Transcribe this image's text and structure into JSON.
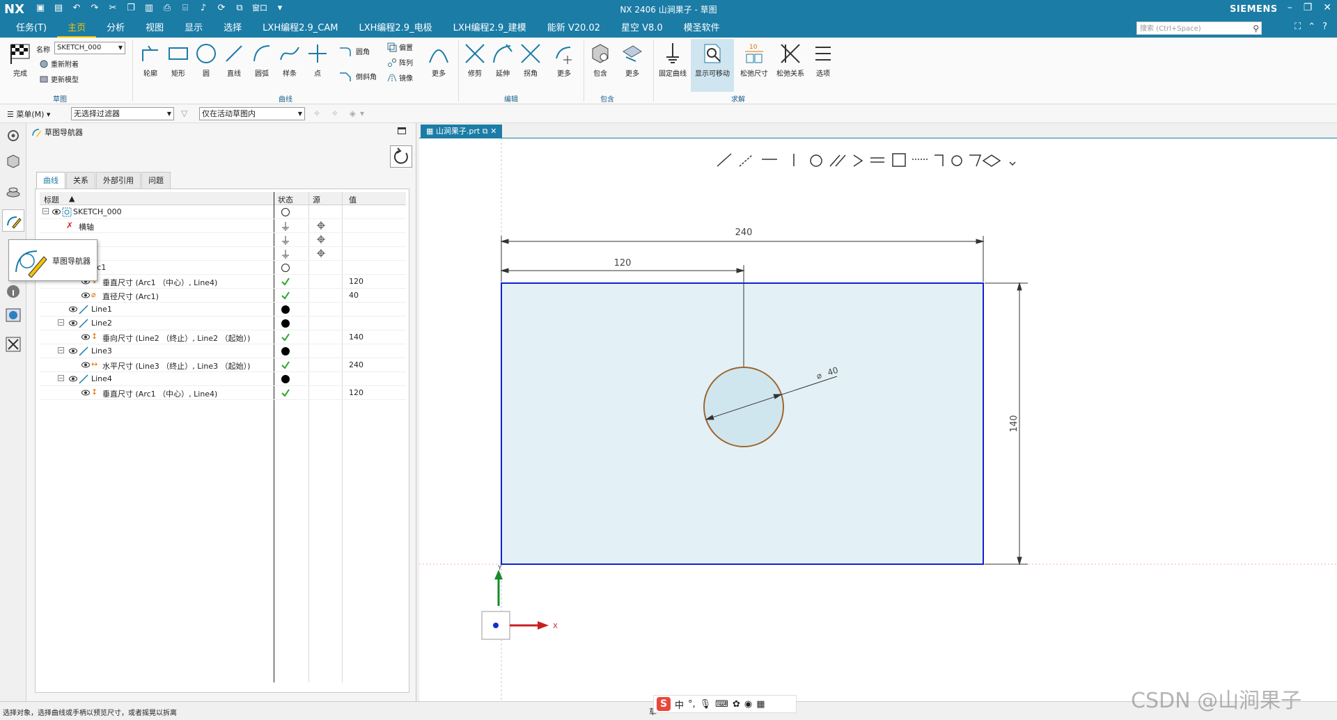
{
  "app": {
    "logo": "NX",
    "window_title": "NX 2406 山涧果子 - 草图",
    "brand": "SIEMENS",
    "window_menu": "窗口"
  },
  "menu_tabs": [
    "任务(T)",
    "主页",
    "分析",
    "视图",
    "显示",
    "选择",
    "LXH编程2.9_CAM",
    "LXH编程2.9_电极",
    "LXH编程2.9_建模",
    "能新 V20.02",
    "星空 V8.0",
    "模圣软件"
  ],
  "active_tab": "主页",
  "search_placeholder": "搜索 (Ctrl+Space)",
  "ribbon": {
    "finish": "完成",
    "name_label": "名称",
    "name_value": "SKETCH_000",
    "reattach": "重新附着",
    "update_model": "更新模型",
    "group_sketch": "草图",
    "curve_buttons": [
      "轮廓",
      "矩形",
      "圆",
      "直线",
      "圆弧",
      "样条",
      "点"
    ],
    "fillet": "圆角",
    "chamfer": "倒斜角",
    "offset": "偏置",
    "pattern": "阵列",
    "mirror": "镜像",
    "more": "更多",
    "group_curve": "曲线",
    "edit_buttons": [
      "修剪",
      "延伸",
      "拐角"
    ],
    "group_edit": "编辑",
    "include": "包含",
    "group_include": "包含",
    "solve_buttons": [
      "固定曲线",
      "显示可移动",
      "松弛尺寸",
      "松弛关系",
      "选项"
    ],
    "group_solve": "求解"
  },
  "filterbar": {
    "menu": "菜单(M)",
    "filter_value": "无选择过滤器",
    "scope_value": "仅在活动草图内"
  },
  "navigator": {
    "title": "草图导航器",
    "tabs": [
      "曲线",
      "关系",
      "外部引用",
      "问题"
    ],
    "columns": [
      "标题",
      "状态",
      "源",
      "值"
    ],
    "tooltip": "草图导航器",
    "rows": [
      {
        "label": "SKETCH_000",
        "value": ""
      },
      {
        "label": "横轴",
        "value": ""
      },
      {
        "label": "rc1",
        "value": ""
      },
      {
        "label": "垂直尺寸 (Arc1 （中心）, Line4)",
        "value": "120"
      },
      {
        "label": "直径尺寸 (Arc1)",
        "value": "40"
      },
      {
        "label": "Line1",
        "value": ""
      },
      {
        "label": "Line2",
        "value": ""
      },
      {
        "label": "垂向尺寸 (Line2 （终止）, Line2 （起始）)",
        "value": "140"
      },
      {
        "label": "Line3",
        "value": ""
      },
      {
        "label": "水平尺寸 (Line3 （终止）, Line3 （起始）)",
        "value": "240"
      },
      {
        "label": "Line4",
        "value": ""
      },
      {
        "label": "垂直尺寸 (Arc1 （中心）, Line4)",
        "value": "120"
      }
    ]
  },
  "document": {
    "tab": "山涧果子.prt"
  },
  "drawing": {
    "dim_width": "240",
    "dim_half": "120",
    "dim_height": "140",
    "dim_diameter": "40",
    "axis_x": "X",
    "axis_y": "Y",
    "fill_color": "#e3f1f7",
    "rect_color": "#1020d0",
    "circle_color": "#a0642c"
  },
  "status": {
    "message": "选择对象，选择曲线或手柄以预览尺寸，或者摇晃以拆离",
    "mode": "草",
    "ime_lang": "中"
  },
  "watermark": "CSDN @山涧果子"
}
